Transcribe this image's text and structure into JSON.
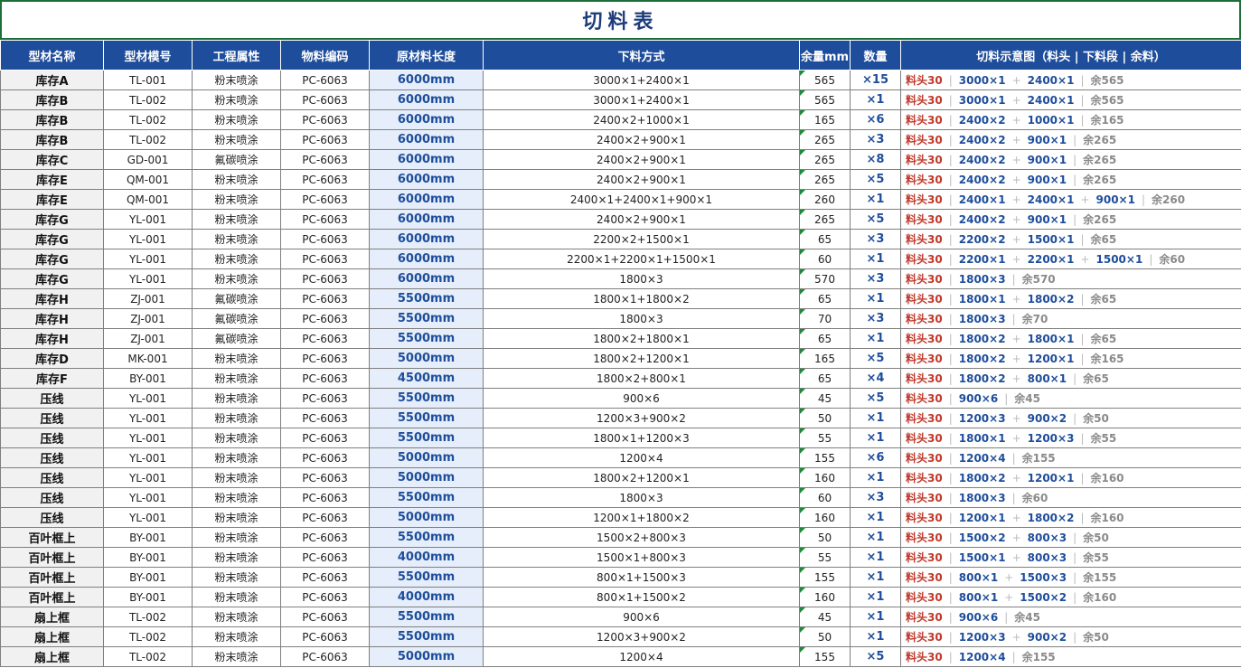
{
  "title": "切料表",
  "headers": [
    "型材名称",
    "型材模号",
    "工程属性",
    "物料编码",
    "原材料长度",
    "下料方式",
    "余量mm",
    "数量",
    "切料示意图（料头 | 下料段 | 余料）"
  ],
  "diagram_head": "料头30",
  "rows": [
    {
      "name": "库存A",
      "model": "TL-001",
      "attr": "粉末喷涂",
      "code": "PC-6063",
      "length": "6000mm",
      "method": "3000×1+2400×1",
      "remain": "565",
      "qty": "×15",
      "segments": [
        "3000×1",
        "2400×1"
      ],
      "rest": "余565"
    },
    {
      "name": "库存B",
      "model": "TL-002",
      "attr": "粉末喷涂",
      "code": "PC-6063",
      "length": "6000mm",
      "method": "3000×1+2400×1",
      "remain": "565",
      "qty": "×1",
      "segments": [
        "3000×1",
        "2400×1"
      ],
      "rest": "余565"
    },
    {
      "name": "库存B",
      "model": "TL-002",
      "attr": "粉末喷涂",
      "code": "PC-6063",
      "length": "6000mm",
      "method": "2400×2+1000×1",
      "remain": "165",
      "qty": "×6",
      "segments": [
        "2400×2",
        "1000×1"
      ],
      "rest": "余165"
    },
    {
      "name": "库存B",
      "model": "TL-002",
      "attr": "粉末喷涂",
      "code": "PC-6063",
      "length": "6000mm",
      "method": "2400×2+900×1",
      "remain": "265",
      "qty": "×3",
      "segments": [
        "2400×2",
        "900×1"
      ],
      "rest": "余265"
    },
    {
      "name": "库存C",
      "model": "GD-001",
      "attr": "氟碳喷涂",
      "code": "PC-6063",
      "length": "6000mm",
      "method": "2400×2+900×1",
      "remain": "265",
      "qty": "×8",
      "segments": [
        "2400×2",
        "900×1"
      ],
      "rest": "余265"
    },
    {
      "name": "库存E",
      "model": "QM-001",
      "attr": "粉末喷涂",
      "code": "PC-6063",
      "length": "6000mm",
      "method": "2400×2+900×1",
      "remain": "265",
      "qty": "×5",
      "segments": [
        "2400×2",
        "900×1"
      ],
      "rest": "余265"
    },
    {
      "name": "库存E",
      "model": "QM-001",
      "attr": "粉末喷涂",
      "code": "PC-6063",
      "length": "6000mm",
      "method": "2400×1+2400×1+900×1",
      "remain": "260",
      "qty": "×1",
      "segments": [
        "2400×1",
        "2400×1",
        "900×1"
      ],
      "rest": "余260"
    },
    {
      "name": "库存G",
      "model": "YL-001",
      "attr": "粉末喷涂",
      "code": "PC-6063",
      "length": "6000mm",
      "method": "2400×2+900×1",
      "remain": "265",
      "qty": "×5",
      "segments": [
        "2400×2",
        "900×1"
      ],
      "rest": "余265"
    },
    {
      "name": "库存G",
      "model": "YL-001",
      "attr": "粉末喷涂",
      "code": "PC-6063",
      "length": "6000mm",
      "method": "2200×2+1500×1",
      "remain": "65",
      "qty": "×3",
      "segments": [
        "2200×2",
        "1500×1"
      ],
      "rest": "余65"
    },
    {
      "name": "库存G",
      "model": "YL-001",
      "attr": "粉末喷涂",
      "code": "PC-6063",
      "length": "6000mm",
      "method": "2200×1+2200×1+1500×1",
      "remain": "60",
      "qty": "×1",
      "segments": [
        "2200×1",
        "2200×1",
        "1500×1"
      ],
      "rest": "余60"
    },
    {
      "name": "库存G",
      "model": "YL-001",
      "attr": "粉末喷涂",
      "code": "PC-6063",
      "length": "6000mm",
      "method": "1800×3",
      "remain": "570",
      "qty": "×3",
      "segments": [
        "1800×3"
      ],
      "rest": "余570"
    },
    {
      "name": "库存H",
      "model": "ZJ-001",
      "attr": "氟碳喷涂",
      "code": "PC-6063",
      "length": "5500mm",
      "method": "1800×1+1800×2",
      "remain": "65",
      "qty": "×1",
      "segments": [
        "1800×1",
        "1800×2"
      ],
      "rest": "余65"
    },
    {
      "name": "库存H",
      "model": "ZJ-001",
      "attr": "氟碳喷涂",
      "code": "PC-6063",
      "length": "5500mm",
      "method": "1800×3",
      "remain": "70",
      "qty": "×3",
      "segments": [
        "1800×3"
      ],
      "rest": "余70"
    },
    {
      "name": "库存H",
      "model": "ZJ-001",
      "attr": "氟碳喷涂",
      "code": "PC-6063",
      "length": "5500mm",
      "method": "1800×2+1800×1",
      "remain": "65",
      "qty": "×1",
      "segments": [
        "1800×2",
        "1800×1"
      ],
      "rest": "余65"
    },
    {
      "name": "库存D",
      "model": "MK-001",
      "attr": "粉末喷涂",
      "code": "PC-6063",
      "length": "5000mm",
      "method": "1800×2+1200×1",
      "remain": "165",
      "qty": "×5",
      "segments": [
        "1800×2",
        "1200×1"
      ],
      "rest": "余165"
    },
    {
      "name": "库存F",
      "model": "BY-001",
      "attr": "粉末喷涂",
      "code": "PC-6063",
      "length": "4500mm",
      "method": "1800×2+800×1",
      "remain": "65",
      "qty": "×4",
      "segments": [
        "1800×2",
        "800×1"
      ],
      "rest": "余65"
    },
    {
      "name": "压线",
      "model": "YL-001",
      "attr": "粉末喷涂",
      "code": "PC-6063",
      "length": "5500mm",
      "method": "900×6",
      "remain": "45",
      "qty": "×5",
      "segments": [
        "900×6"
      ],
      "rest": "余45"
    },
    {
      "name": "压线",
      "model": "YL-001",
      "attr": "粉末喷涂",
      "code": "PC-6063",
      "length": "5500mm",
      "method": "1200×3+900×2",
      "remain": "50",
      "qty": "×1",
      "segments": [
        "1200×3",
        "900×2"
      ],
      "rest": "余50"
    },
    {
      "name": "压线",
      "model": "YL-001",
      "attr": "粉末喷涂",
      "code": "PC-6063",
      "length": "5500mm",
      "method": "1800×1+1200×3",
      "remain": "55",
      "qty": "×1",
      "segments": [
        "1800×1",
        "1200×3"
      ],
      "rest": "余55"
    },
    {
      "name": "压线",
      "model": "YL-001",
      "attr": "粉末喷涂",
      "code": "PC-6063",
      "length": "5000mm",
      "method": "1200×4",
      "remain": "155",
      "qty": "×6",
      "segments": [
        "1200×4"
      ],
      "rest": "余155"
    },
    {
      "name": "压线",
      "model": "YL-001",
      "attr": "粉末喷涂",
      "code": "PC-6063",
      "length": "5000mm",
      "method": "1800×2+1200×1",
      "remain": "160",
      "qty": "×1",
      "segments": [
        "1800×2",
        "1200×1"
      ],
      "rest": "余160"
    },
    {
      "name": "压线",
      "model": "YL-001",
      "attr": "粉末喷涂",
      "code": "PC-6063",
      "length": "5500mm",
      "method": "1800×3",
      "remain": "60",
      "qty": "×3",
      "segments": [
        "1800×3"
      ],
      "rest": "余60"
    },
    {
      "name": "压线",
      "model": "YL-001",
      "attr": "粉末喷涂",
      "code": "PC-6063",
      "length": "5000mm",
      "method": "1200×1+1800×2",
      "remain": "160",
      "qty": "×1",
      "segments": [
        "1200×1",
        "1800×2"
      ],
      "rest": "余160"
    },
    {
      "name": "百叶框上",
      "model": "BY-001",
      "attr": "粉末喷涂",
      "code": "PC-6063",
      "length": "5500mm",
      "method": "1500×2+800×3",
      "remain": "50",
      "qty": "×1",
      "segments": [
        "1500×2",
        "800×3"
      ],
      "rest": "余50"
    },
    {
      "name": "百叶框上",
      "model": "BY-001",
      "attr": "粉末喷涂",
      "code": "PC-6063",
      "length": "4000mm",
      "method": "1500×1+800×3",
      "remain": "55",
      "qty": "×1",
      "segments": [
        "1500×1",
        "800×3"
      ],
      "rest": "余55"
    },
    {
      "name": "百叶框上",
      "model": "BY-001",
      "attr": "粉末喷涂",
      "code": "PC-6063",
      "length": "5500mm",
      "method": "800×1+1500×3",
      "remain": "155",
      "qty": "×1",
      "segments": [
        "800×1",
        "1500×3"
      ],
      "rest": "余155"
    },
    {
      "name": "百叶框上",
      "model": "BY-001",
      "attr": "粉末喷涂",
      "code": "PC-6063",
      "length": "4000mm",
      "method": "800×1+1500×2",
      "remain": "160",
      "qty": "×1",
      "segments": [
        "800×1",
        "1500×2"
      ],
      "rest": "余160"
    },
    {
      "name": "扇上框",
      "model": "TL-002",
      "attr": "粉末喷涂",
      "code": "PC-6063",
      "length": "5500mm",
      "method": "900×6",
      "remain": "45",
      "qty": "×1",
      "segments": [
        "900×6"
      ],
      "rest": "余45"
    },
    {
      "name": "扇上框",
      "model": "TL-002",
      "attr": "粉末喷涂",
      "code": "PC-6063",
      "length": "5500mm",
      "method": "1200×3+900×2",
      "remain": "50",
      "qty": "×1",
      "segments": [
        "1200×3",
        "900×2"
      ],
      "rest": "余50"
    },
    {
      "name": "扇上框",
      "model": "TL-002",
      "attr": "粉末喷涂",
      "code": "PC-6063",
      "length": "5000mm",
      "method": "1200×4",
      "remain": "155",
      "qty": "×5",
      "segments": [
        "1200×4"
      ],
      "rest": "余155"
    }
  ]
}
